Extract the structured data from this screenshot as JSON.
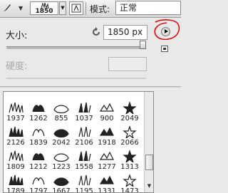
{
  "options_bar": {
    "brush_preset_size": "1850",
    "mode_label": "模式:",
    "mode_value": "正常"
  },
  "panel": {
    "size_label": "大小:",
    "size_value": "1850 px",
    "hardness_label": "硬度:",
    "size_slider_fraction": 0.98,
    "icons": {
      "reset": "reset-size-icon",
      "menu": "panel-menu-icon",
      "new_preset": "new-preset-icon"
    },
    "annotation_color": "#d81010"
  },
  "presets": [
    [
      "1937",
      "1262",
      "855",
      "1037",
      "900",
      "2049"
    ],
    [
      "2126",
      "1839",
      "2042",
      "2106",
      "1918",
      "2066"
    ],
    [
      "1809",
      "1212",
      "1223",
      "1558",
      "1277",
      "1313"
    ],
    [
      "1789",
      "1797",
      "1667",
      "1195",
      "1331",
      "1473"
    ]
  ]
}
